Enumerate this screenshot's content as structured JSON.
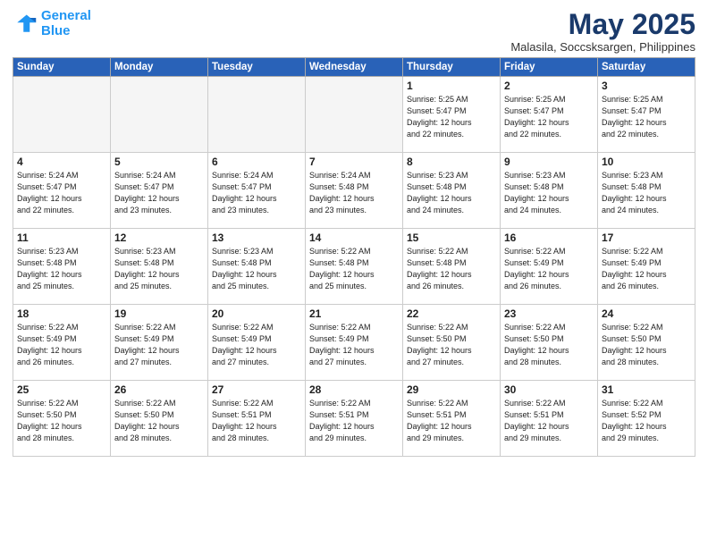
{
  "header": {
    "logo_line1": "General",
    "logo_line2": "Blue",
    "month_title": "May 2025",
    "subtitle": "Malasila, Soccsksargen, Philippines"
  },
  "weekdays": [
    "Sunday",
    "Monday",
    "Tuesday",
    "Wednesday",
    "Thursday",
    "Friday",
    "Saturday"
  ],
  "weeks": [
    [
      {
        "day": "",
        "info": ""
      },
      {
        "day": "",
        "info": ""
      },
      {
        "day": "",
        "info": ""
      },
      {
        "day": "",
        "info": ""
      },
      {
        "day": "1",
        "info": "Sunrise: 5:25 AM\nSunset: 5:47 PM\nDaylight: 12 hours\nand 22 minutes."
      },
      {
        "day": "2",
        "info": "Sunrise: 5:25 AM\nSunset: 5:47 PM\nDaylight: 12 hours\nand 22 minutes."
      },
      {
        "day": "3",
        "info": "Sunrise: 5:25 AM\nSunset: 5:47 PM\nDaylight: 12 hours\nand 22 minutes."
      }
    ],
    [
      {
        "day": "4",
        "info": "Sunrise: 5:24 AM\nSunset: 5:47 PM\nDaylight: 12 hours\nand 22 minutes."
      },
      {
        "day": "5",
        "info": "Sunrise: 5:24 AM\nSunset: 5:47 PM\nDaylight: 12 hours\nand 23 minutes."
      },
      {
        "day": "6",
        "info": "Sunrise: 5:24 AM\nSunset: 5:47 PM\nDaylight: 12 hours\nand 23 minutes."
      },
      {
        "day": "7",
        "info": "Sunrise: 5:24 AM\nSunset: 5:48 PM\nDaylight: 12 hours\nand 23 minutes."
      },
      {
        "day": "8",
        "info": "Sunrise: 5:23 AM\nSunset: 5:48 PM\nDaylight: 12 hours\nand 24 minutes."
      },
      {
        "day": "9",
        "info": "Sunrise: 5:23 AM\nSunset: 5:48 PM\nDaylight: 12 hours\nand 24 minutes."
      },
      {
        "day": "10",
        "info": "Sunrise: 5:23 AM\nSunset: 5:48 PM\nDaylight: 12 hours\nand 24 minutes."
      }
    ],
    [
      {
        "day": "11",
        "info": "Sunrise: 5:23 AM\nSunset: 5:48 PM\nDaylight: 12 hours\nand 25 minutes."
      },
      {
        "day": "12",
        "info": "Sunrise: 5:23 AM\nSunset: 5:48 PM\nDaylight: 12 hours\nand 25 minutes."
      },
      {
        "day": "13",
        "info": "Sunrise: 5:23 AM\nSunset: 5:48 PM\nDaylight: 12 hours\nand 25 minutes."
      },
      {
        "day": "14",
        "info": "Sunrise: 5:22 AM\nSunset: 5:48 PM\nDaylight: 12 hours\nand 25 minutes."
      },
      {
        "day": "15",
        "info": "Sunrise: 5:22 AM\nSunset: 5:48 PM\nDaylight: 12 hours\nand 26 minutes."
      },
      {
        "day": "16",
        "info": "Sunrise: 5:22 AM\nSunset: 5:49 PM\nDaylight: 12 hours\nand 26 minutes."
      },
      {
        "day": "17",
        "info": "Sunrise: 5:22 AM\nSunset: 5:49 PM\nDaylight: 12 hours\nand 26 minutes."
      }
    ],
    [
      {
        "day": "18",
        "info": "Sunrise: 5:22 AM\nSunset: 5:49 PM\nDaylight: 12 hours\nand 26 minutes."
      },
      {
        "day": "19",
        "info": "Sunrise: 5:22 AM\nSunset: 5:49 PM\nDaylight: 12 hours\nand 27 minutes."
      },
      {
        "day": "20",
        "info": "Sunrise: 5:22 AM\nSunset: 5:49 PM\nDaylight: 12 hours\nand 27 minutes."
      },
      {
        "day": "21",
        "info": "Sunrise: 5:22 AM\nSunset: 5:49 PM\nDaylight: 12 hours\nand 27 minutes."
      },
      {
        "day": "22",
        "info": "Sunrise: 5:22 AM\nSunset: 5:50 PM\nDaylight: 12 hours\nand 27 minutes."
      },
      {
        "day": "23",
        "info": "Sunrise: 5:22 AM\nSunset: 5:50 PM\nDaylight: 12 hours\nand 28 minutes."
      },
      {
        "day": "24",
        "info": "Sunrise: 5:22 AM\nSunset: 5:50 PM\nDaylight: 12 hours\nand 28 minutes."
      }
    ],
    [
      {
        "day": "25",
        "info": "Sunrise: 5:22 AM\nSunset: 5:50 PM\nDaylight: 12 hours\nand 28 minutes."
      },
      {
        "day": "26",
        "info": "Sunrise: 5:22 AM\nSunset: 5:50 PM\nDaylight: 12 hours\nand 28 minutes."
      },
      {
        "day": "27",
        "info": "Sunrise: 5:22 AM\nSunset: 5:51 PM\nDaylight: 12 hours\nand 28 minutes."
      },
      {
        "day": "28",
        "info": "Sunrise: 5:22 AM\nSunset: 5:51 PM\nDaylight: 12 hours\nand 29 minutes."
      },
      {
        "day": "29",
        "info": "Sunrise: 5:22 AM\nSunset: 5:51 PM\nDaylight: 12 hours\nand 29 minutes."
      },
      {
        "day": "30",
        "info": "Sunrise: 5:22 AM\nSunset: 5:51 PM\nDaylight: 12 hours\nand 29 minutes."
      },
      {
        "day": "31",
        "info": "Sunrise: 5:22 AM\nSunset: 5:52 PM\nDaylight: 12 hours\nand 29 minutes."
      }
    ]
  ]
}
